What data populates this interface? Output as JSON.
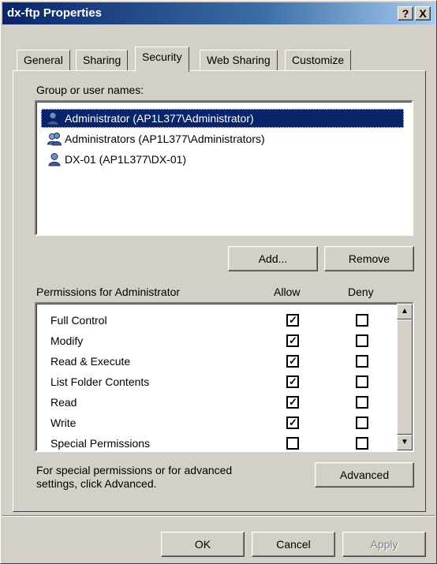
{
  "window": {
    "title": "dx-ftp Properties",
    "help_label": "?",
    "close_label": "X"
  },
  "tabs": [
    {
      "label": "General"
    },
    {
      "label": "Sharing"
    },
    {
      "label": "Security",
      "active": true
    },
    {
      "label": "Web Sharing"
    },
    {
      "label": "Customize"
    }
  ],
  "security": {
    "group_label": "Group or user names:",
    "users": [
      {
        "name": "Administrator (AP1L377\\Administrator)",
        "icon": "user-icon",
        "selected": true
      },
      {
        "name": "Administrators (AP1L377\\Administrators)",
        "icon": "group-icon",
        "selected": false
      },
      {
        "name": "DX-01 (AP1L377\\DX-01)",
        "icon": "user-icon",
        "selected": false
      }
    ],
    "add_label": "Add...",
    "remove_label": "Remove",
    "permissions_label": "Permissions for Administrator",
    "allow_label": "Allow",
    "deny_label": "Deny",
    "permissions": [
      {
        "name": "Full Control",
        "allow": true,
        "deny": false
      },
      {
        "name": "Modify",
        "allow": true,
        "deny": false
      },
      {
        "name": "Read & Execute",
        "allow": true,
        "deny": false
      },
      {
        "name": "List Folder Contents",
        "allow": true,
        "deny": false
      },
      {
        "name": "Read",
        "allow": true,
        "deny": false
      },
      {
        "name": "Write",
        "allow": true,
        "deny": false
      },
      {
        "name": "Special Permissions",
        "allow": false,
        "deny": false
      }
    ],
    "advanced_text": "For special permissions or for advanced settings, click Advanced.",
    "advanced_label": "Advanced"
  },
  "footer": {
    "ok_label": "OK",
    "cancel_label": "Cancel",
    "apply_label": "Apply"
  }
}
